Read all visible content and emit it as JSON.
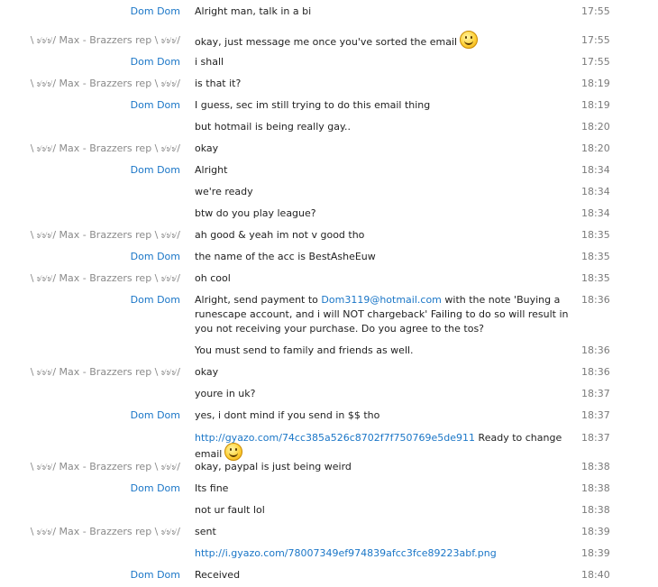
{
  "messages": [
    {
      "sender": "Dom Dom",
      "who": "dom",
      "parts": [
        {
          "text": "Alright man, talk in a bi"
        }
      ],
      "time": "17:55"
    },
    {
      "sender": "\\ ৶৶৶/ Max - Brazzers rep \\ ৶৶৶/",
      "who": "max",
      "parts": [
        {
          "text": "okay, just message me once you've sorted the email"
        },
        {
          "emoji": "smiley-icon"
        }
      ],
      "time": "17:55"
    },
    {
      "sender": "Dom Dom",
      "who": "dom",
      "parts": [
        {
          "text": "i shall"
        }
      ],
      "time": "17:55"
    },
    {
      "sender": "\\ ৶৶৶/ Max - Brazzers rep \\ ৶৶৶/",
      "who": "max",
      "parts": [
        {
          "text": "is that it?"
        }
      ],
      "time": "18:19"
    },
    {
      "sender": "Dom Dom",
      "who": "dom",
      "parts": [
        {
          "text": "I guess, sec im still trying to do this email thing"
        }
      ],
      "time": "18:19"
    },
    {
      "sender": "",
      "who": "dom",
      "parts": [
        {
          "text": "but hotmail is being really gay.."
        }
      ],
      "time": "18:20"
    },
    {
      "sender": "\\ ৶৶৶/ Max - Brazzers rep \\ ৶৶৶/",
      "who": "max",
      "parts": [
        {
          "text": "okay"
        }
      ],
      "time": "18:20"
    },
    {
      "sender": "Dom Dom",
      "who": "dom",
      "parts": [
        {
          "text": "Alright"
        }
      ],
      "time": "18:34"
    },
    {
      "sender": "",
      "who": "dom",
      "parts": [
        {
          "text": "we're ready"
        }
      ],
      "time": "18:34"
    },
    {
      "sender": "",
      "who": "dom",
      "parts": [
        {
          "text": "btw do you play league?"
        }
      ],
      "time": "18:34"
    },
    {
      "sender": "\\ ৶৶৶/ Max - Brazzers rep \\ ৶৶৶/",
      "who": "max",
      "parts": [
        {
          "text": "ah good & yeah im not v good tho"
        }
      ],
      "time": "18:35"
    },
    {
      "sender": "Dom Dom",
      "who": "dom",
      "parts": [
        {
          "text": "the name of the acc is BestAsheEuw"
        }
      ],
      "time": "18:35"
    },
    {
      "sender": "\\ ৶৶৶/ Max - Brazzers rep \\ ৶৶৶/",
      "who": "max",
      "parts": [
        {
          "text": "oh cool"
        }
      ],
      "time": "18:35"
    },
    {
      "sender": "Dom Dom",
      "who": "dom",
      "parts": [
        {
          "text": "Alright, send payment to "
        },
        {
          "link": "Dom3119@hotmail.com"
        },
        {
          "text": " with the note 'Buying a runescape account, and i will NOT chargeback' Failing to do so will result in you not receiving your purchase. Do you agree to the tos?"
        }
      ],
      "time": "18:36"
    },
    {
      "sender": "",
      "who": "dom",
      "parts": [
        {
          "text": "You must send to family and friends as well."
        }
      ],
      "time": "18:36"
    },
    {
      "sender": "\\ ৶৶৶/ Max - Brazzers rep \\ ৶৶৶/",
      "who": "max",
      "parts": [
        {
          "text": "okay"
        }
      ],
      "time": "18:36"
    },
    {
      "sender": "",
      "who": "max",
      "parts": [
        {
          "text": "youre in uk?"
        }
      ],
      "time": "18:37"
    },
    {
      "sender": "Dom Dom",
      "who": "dom",
      "parts": [
        {
          "text": "yes, i dont mind if you send in $$ tho"
        }
      ],
      "time": "18:37"
    },
    {
      "sender": "",
      "who": "dom",
      "parts": [
        {
          "link": "http://gyazo.com/74cc385a526c8702f7f750769e5de911"
        },
        {
          "text": " Ready to change email"
        },
        {
          "emoji": "smiley-icon"
        }
      ],
      "time": "18:37"
    },
    {
      "sender": "\\ ৶৶৶/ Max - Brazzers rep \\ ৶৶৶/",
      "who": "max",
      "parts": [
        {
          "text": "okay, paypal is just being weird"
        }
      ],
      "time": "18:38"
    },
    {
      "sender": "Dom Dom",
      "who": "dom",
      "parts": [
        {
          "text": "Its fine"
        }
      ],
      "time": "18:38"
    },
    {
      "sender": "",
      "who": "dom",
      "parts": [
        {
          "text": "not ur fault lol"
        }
      ],
      "time": "18:38"
    },
    {
      "sender": "\\ ৶৶৶/ Max - Brazzers rep \\ ৶৶৶/",
      "who": "max",
      "parts": [
        {
          "text": "sent"
        }
      ],
      "time": "18:39"
    },
    {
      "sender": "",
      "who": "max",
      "parts": [
        {
          "link": "http://i.gyazo.com/78007349ef974839afcc3fce89223abf.png"
        }
      ],
      "time": "18:39"
    },
    {
      "sender": "Dom Dom",
      "who": "dom",
      "parts": [
        {
          "text": "Received"
        }
      ],
      "time": "18:40"
    }
  ],
  "colors": {
    "dom_name": "#1a76c7",
    "max_name": "#8a8a8a",
    "link": "#1a76c7",
    "time": "#7a7a7a"
  }
}
